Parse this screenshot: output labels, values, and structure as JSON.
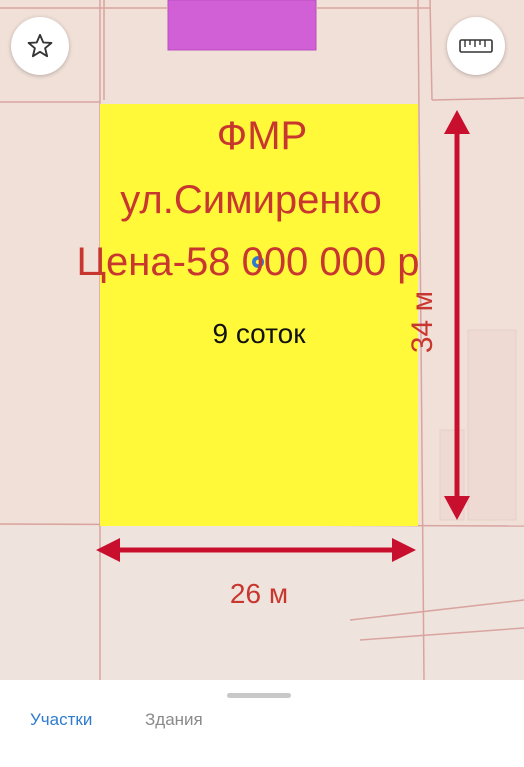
{
  "map": {
    "background_color": "#f0e0d8",
    "plot_color": "#fff93a",
    "annotation_color": "#c8372f",
    "neighbor_plot_color": "#d15fd6",
    "favorite_icon": "star-icon",
    "ruler_icon": "ruler-icon"
  },
  "plot": {
    "title": "ФМР",
    "street": "ул.Симиренко",
    "price": "Цена-58 000 000 р",
    "area": "9 соток",
    "height_label": "34 м",
    "width_label": "26 м"
  },
  "tabs": {
    "active_color": "#2e7ccf",
    "items": [
      {
        "label": "Участки",
        "active": true
      },
      {
        "label": "Здания",
        "active": false
      }
    ]
  }
}
